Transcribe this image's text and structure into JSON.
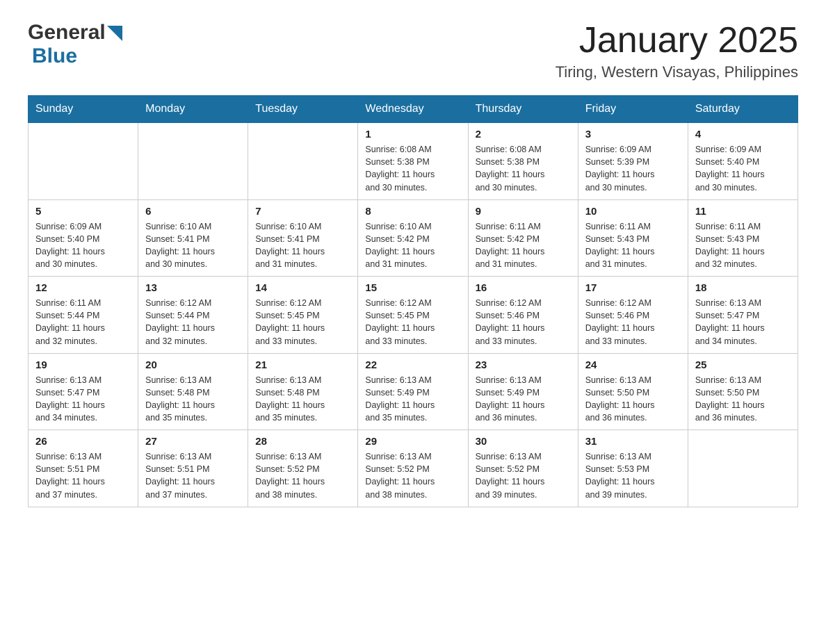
{
  "header": {
    "logo_general": "General",
    "logo_blue": "Blue",
    "month_title": "January 2025",
    "location": "Tiring, Western Visayas, Philippines"
  },
  "days_of_week": [
    "Sunday",
    "Monday",
    "Tuesday",
    "Wednesday",
    "Thursday",
    "Friday",
    "Saturday"
  ],
  "weeks": [
    [
      {
        "day": "",
        "info": ""
      },
      {
        "day": "",
        "info": ""
      },
      {
        "day": "",
        "info": ""
      },
      {
        "day": "1",
        "info": "Sunrise: 6:08 AM\nSunset: 5:38 PM\nDaylight: 11 hours\nand 30 minutes."
      },
      {
        "day": "2",
        "info": "Sunrise: 6:08 AM\nSunset: 5:38 PM\nDaylight: 11 hours\nand 30 minutes."
      },
      {
        "day": "3",
        "info": "Sunrise: 6:09 AM\nSunset: 5:39 PM\nDaylight: 11 hours\nand 30 minutes."
      },
      {
        "day": "4",
        "info": "Sunrise: 6:09 AM\nSunset: 5:40 PM\nDaylight: 11 hours\nand 30 minutes."
      }
    ],
    [
      {
        "day": "5",
        "info": "Sunrise: 6:09 AM\nSunset: 5:40 PM\nDaylight: 11 hours\nand 30 minutes."
      },
      {
        "day": "6",
        "info": "Sunrise: 6:10 AM\nSunset: 5:41 PM\nDaylight: 11 hours\nand 30 minutes."
      },
      {
        "day": "7",
        "info": "Sunrise: 6:10 AM\nSunset: 5:41 PM\nDaylight: 11 hours\nand 31 minutes."
      },
      {
        "day": "8",
        "info": "Sunrise: 6:10 AM\nSunset: 5:42 PM\nDaylight: 11 hours\nand 31 minutes."
      },
      {
        "day": "9",
        "info": "Sunrise: 6:11 AM\nSunset: 5:42 PM\nDaylight: 11 hours\nand 31 minutes."
      },
      {
        "day": "10",
        "info": "Sunrise: 6:11 AM\nSunset: 5:43 PM\nDaylight: 11 hours\nand 31 minutes."
      },
      {
        "day": "11",
        "info": "Sunrise: 6:11 AM\nSunset: 5:43 PM\nDaylight: 11 hours\nand 32 minutes."
      }
    ],
    [
      {
        "day": "12",
        "info": "Sunrise: 6:11 AM\nSunset: 5:44 PM\nDaylight: 11 hours\nand 32 minutes."
      },
      {
        "day": "13",
        "info": "Sunrise: 6:12 AM\nSunset: 5:44 PM\nDaylight: 11 hours\nand 32 minutes."
      },
      {
        "day": "14",
        "info": "Sunrise: 6:12 AM\nSunset: 5:45 PM\nDaylight: 11 hours\nand 33 minutes."
      },
      {
        "day": "15",
        "info": "Sunrise: 6:12 AM\nSunset: 5:45 PM\nDaylight: 11 hours\nand 33 minutes."
      },
      {
        "day": "16",
        "info": "Sunrise: 6:12 AM\nSunset: 5:46 PM\nDaylight: 11 hours\nand 33 minutes."
      },
      {
        "day": "17",
        "info": "Sunrise: 6:12 AM\nSunset: 5:46 PM\nDaylight: 11 hours\nand 33 minutes."
      },
      {
        "day": "18",
        "info": "Sunrise: 6:13 AM\nSunset: 5:47 PM\nDaylight: 11 hours\nand 34 minutes."
      }
    ],
    [
      {
        "day": "19",
        "info": "Sunrise: 6:13 AM\nSunset: 5:47 PM\nDaylight: 11 hours\nand 34 minutes."
      },
      {
        "day": "20",
        "info": "Sunrise: 6:13 AM\nSunset: 5:48 PM\nDaylight: 11 hours\nand 35 minutes."
      },
      {
        "day": "21",
        "info": "Sunrise: 6:13 AM\nSunset: 5:48 PM\nDaylight: 11 hours\nand 35 minutes."
      },
      {
        "day": "22",
        "info": "Sunrise: 6:13 AM\nSunset: 5:49 PM\nDaylight: 11 hours\nand 35 minutes."
      },
      {
        "day": "23",
        "info": "Sunrise: 6:13 AM\nSunset: 5:49 PM\nDaylight: 11 hours\nand 36 minutes."
      },
      {
        "day": "24",
        "info": "Sunrise: 6:13 AM\nSunset: 5:50 PM\nDaylight: 11 hours\nand 36 minutes."
      },
      {
        "day": "25",
        "info": "Sunrise: 6:13 AM\nSunset: 5:50 PM\nDaylight: 11 hours\nand 36 minutes."
      }
    ],
    [
      {
        "day": "26",
        "info": "Sunrise: 6:13 AM\nSunset: 5:51 PM\nDaylight: 11 hours\nand 37 minutes."
      },
      {
        "day": "27",
        "info": "Sunrise: 6:13 AM\nSunset: 5:51 PM\nDaylight: 11 hours\nand 37 minutes."
      },
      {
        "day": "28",
        "info": "Sunrise: 6:13 AM\nSunset: 5:52 PM\nDaylight: 11 hours\nand 38 minutes."
      },
      {
        "day": "29",
        "info": "Sunrise: 6:13 AM\nSunset: 5:52 PM\nDaylight: 11 hours\nand 38 minutes."
      },
      {
        "day": "30",
        "info": "Sunrise: 6:13 AM\nSunset: 5:52 PM\nDaylight: 11 hours\nand 39 minutes."
      },
      {
        "day": "31",
        "info": "Sunrise: 6:13 AM\nSunset: 5:53 PM\nDaylight: 11 hours\nand 39 minutes."
      },
      {
        "day": "",
        "info": ""
      }
    ]
  ]
}
